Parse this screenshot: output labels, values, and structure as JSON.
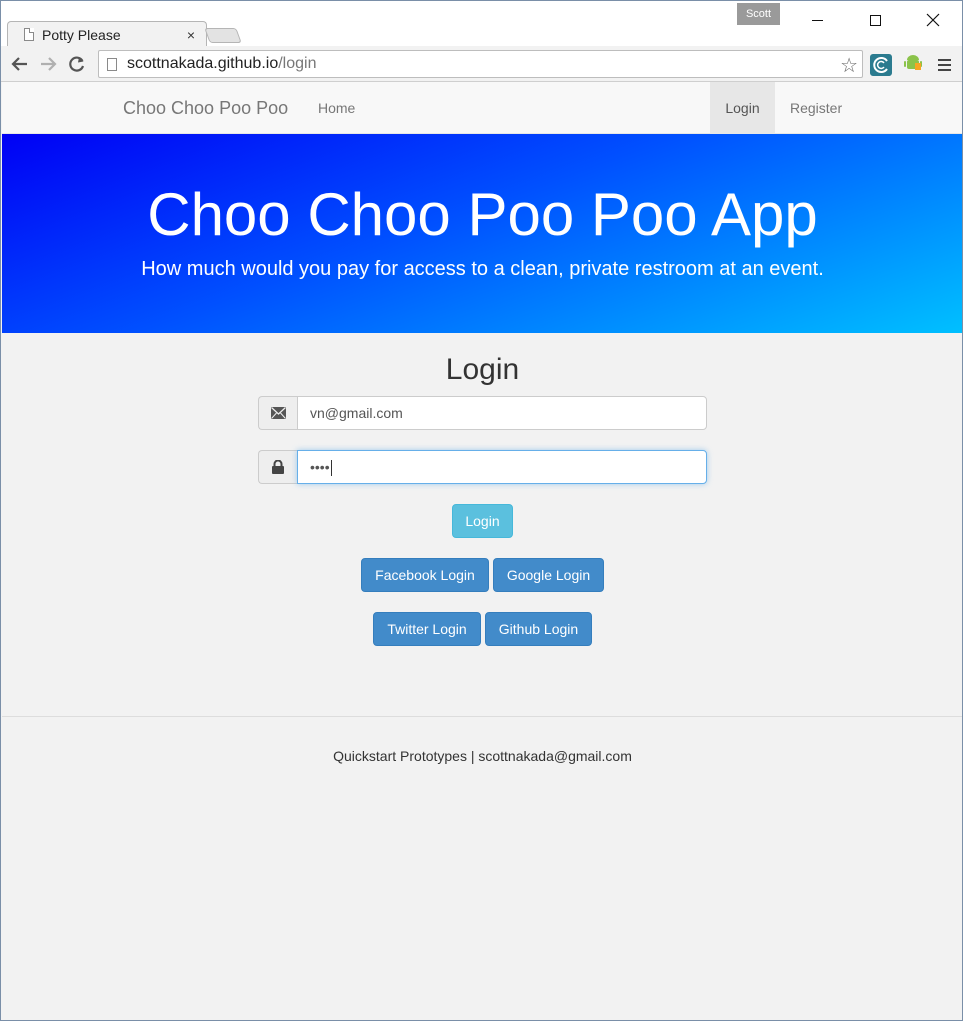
{
  "browser": {
    "tab_title": "Potty Please",
    "tab_close": "×",
    "profile_name": "Scott",
    "url_host": "scottnakada.github.io",
    "url_path": "/login",
    "star_icon": "☆"
  },
  "navbar": {
    "brand": "Choo Choo Poo Poo",
    "home": "Home",
    "login": "Login",
    "register": "Register"
  },
  "hero": {
    "title": "Choo Choo Poo Poo App",
    "subtitle": "How much would you pay for access to a clean, private restroom at an event."
  },
  "login_form": {
    "title": "Login",
    "email_value": "vn@gmail.com",
    "password_value": "••••",
    "email_icon": "✉",
    "lock_icon": "🔒",
    "login_button": "Login",
    "facebook_button": "Facebook Login",
    "google_button": "Google Login",
    "twitter_button": "Twitter Login",
    "github_button": "Github Login"
  },
  "footer": {
    "text": "Quickstart Prototypes | scottnakada@gmail.com"
  },
  "colors": {
    "hero_gradient_start": "#0000f5",
    "hero_gradient_end": "#00c0ff",
    "btn_primary": "#428bca",
    "btn_info": "#5bc0de"
  }
}
